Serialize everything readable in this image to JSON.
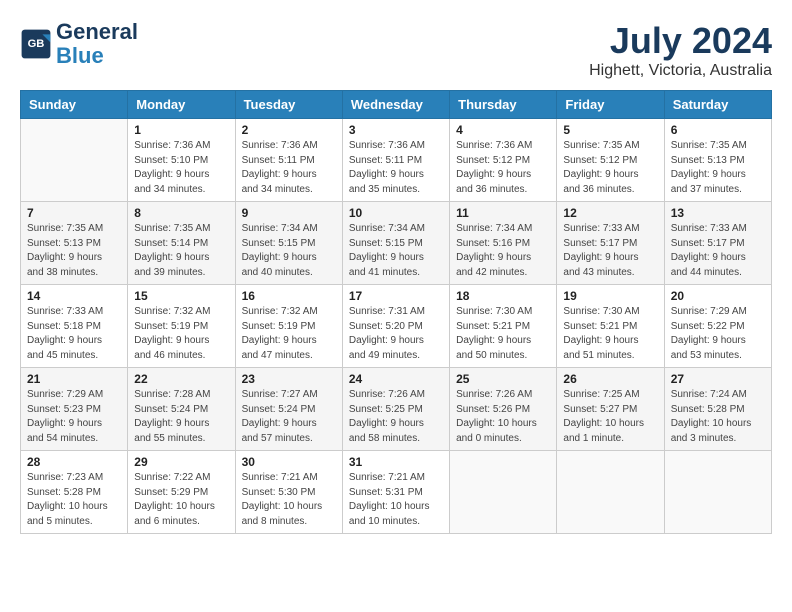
{
  "header": {
    "logo_line1": "General",
    "logo_line2": "Blue",
    "month_year": "July 2024",
    "location": "Highett, Victoria, Australia"
  },
  "days_of_week": [
    "Sunday",
    "Monday",
    "Tuesday",
    "Wednesday",
    "Thursday",
    "Friday",
    "Saturday"
  ],
  "weeks": [
    [
      {
        "day": "",
        "info": ""
      },
      {
        "day": "1",
        "info": "Sunrise: 7:36 AM\nSunset: 5:10 PM\nDaylight: 9 hours\nand 34 minutes."
      },
      {
        "day": "2",
        "info": "Sunrise: 7:36 AM\nSunset: 5:11 PM\nDaylight: 9 hours\nand 34 minutes."
      },
      {
        "day": "3",
        "info": "Sunrise: 7:36 AM\nSunset: 5:11 PM\nDaylight: 9 hours\nand 35 minutes."
      },
      {
        "day": "4",
        "info": "Sunrise: 7:36 AM\nSunset: 5:12 PM\nDaylight: 9 hours\nand 36 minutes."
      },
      {
        "day": "5",
        "info": "Sunrise: 7:35 AM\nSunset: 5:12 PM\nDaylight: 9 hours\nand 36 minutes."
      },
      {
        "day": "6",
        "info": "Sunrise: 7:35 AM\nSunset: 5:13 PM\nDaylight: 9 hours\nand 37 minutes."
      }
    ],
    [
      {
        "day": "7",
        "info": "Sunrise: 7:35 AM\nSunset: 5:13 PM\nDaylight: 9 hours\nand 38 minutes."
      },
      {
        "day": "8",
        "info": "Sunrise: 7:35 AM\nSunset: 5:14 PM\nDaylight: 9 hours\nand 39 minutes."
      },
      {
        "day": "9",
        "info": "Sunrise: 7:34 AM\nSunset: 5:15 PM\nDaylight: 9 hours\nand 40 minutes."
      },
      {
        "day": "10",
        "info": "Sunrise: 7:34 AM\nSunset: 5:15 PM\nDaylight: 9 hours\nand 41 minutes."
      },
      {
        "day": "11",
        "info": "Sunrise: 7:34 AM\nSunset: 5:16 PM\nDaylight: 9 hours\nand 42 minutes."
      },
      {
        "day": "12",
        "info": "Sunrise: 7:33 AM\nSunset: 5:17 PM\nDaylight: 9 hours\nand 43 minutes."
      },
      {
        "day": "13",
        "info": "Sunrise: 7:33 AM\nSunset: 5:17 PM\nDaylight: 9 hours\nand 44 minutes."
      }
    ],
    [
      {
        "day": "14",
        "info": "Sunrise: 7:33 AM\nSunset: 5:18 PM\nDaylight: 9 hours\nand 45 minutes."
      },
      {
        "day": "15",
        "info": "Sunrise: 7:32 AM\nSunset: 5:19 PM\nDaylight: 9 hours\nand 46 minutes."
      },
      {
        "day": "16",
        "info": "Sunrise: 7:32 AM\nSunset: 5:19 PM\nDaylight: 9 hours\nand 47 minutes."
      },
      {
        "day": "17",
        "info": "Sunrise: 7:31 AM\nSunset: 5:20 PM\nDaylight: 9 hours\nand 49 minutes."
      },
      {
        "day": "18",
        "info": "Sunrise: 7:30 AM\nSunset: 5:21 PM\nDaylight: 9 hours\nand 50 minutes."
      },
      {
        "day": "19",
        "info": "Sunrise: 7:30 AM\nSunset: 5:21 PM\nDaylight: 9 hours\nand 51 minutes."
      },
      {
        "day": "20",
        "info": "Sunrise: 7:29 AM\nSunset: 5:22 PM\nDaylight: 9 hours\nand 53 minutes."
      }
    ],
    [
      {
        "day": "21",
        "info": "Sunrise: 7:29 AM\nSunset: 5:23 PM\nDaylight: 9 hours\nand 54 minutes."
      },
      {
        "day": "22",
        "info": "Sunrise: 7:28 AM\nSunset: 5:24 PM\nDaylight: 9 hours\nand 55 minutes."
      },
      {
        "day": "23",
        "info": "Sunrise: 7:27 AM\nSunset: 5:24 PM\nDaylight: 9 hours\nand 57 minutes."
      },
      {
        "day": "24",
        "info": "Sunrise: 7:26 AM\nSunset: 5:25 PM\nDaylight: 9 hours\nand 58 minutes."
      },
      {
        "day": "25",
        "info": "Sunrise: 7:26 AM\nSunset: 5:26 PM\nDaylight: 10 hours\nand 0 minutes."
      },
      {
        "day": "26",
        "info": "Sunrise: 7:25 AM\nSunset: 5:27 PM\nDaylight: 10 hours\nand 1 minute."
      },
      {
        "day": "27",
        "info": "Sunrise: 7:24 AM\nSunset: 5:28 PM\nDaylight: 10 hours\nand 3 minutes."
      }
    ],
    [
      {
        "day": "28",
        "info": "Sunrise: 7:23 AM\nSunset: 5:28 PM\nDaylight: 10 hours\nand 5 minutes."
      },
      {
        "day": "29",
        "info": "Sunrise: 7:22 AM\nSunset: 5:29 PM\nDaylight: 10 hours\nand 6 minutes."
      },
      {
        "day": "30",
        "info": "Sunrise: 7:21 AM\nSunset: 5:30 PM\nDaylight: 10 hours\nand 8 minutes."
      },
      {
        "day": "31",
        "info": "Sunrise: 7:21 AM\nSunset: 5:31 PM\nDaylight: 10 hours\nand 10 minutes."
      },
      {
        "day": "",
        "info": ""
      },
      {
        "day": "",
        "info": ""
      },
      {
        "day": "",
        "info": ""
      }
    ]
  ]
}
